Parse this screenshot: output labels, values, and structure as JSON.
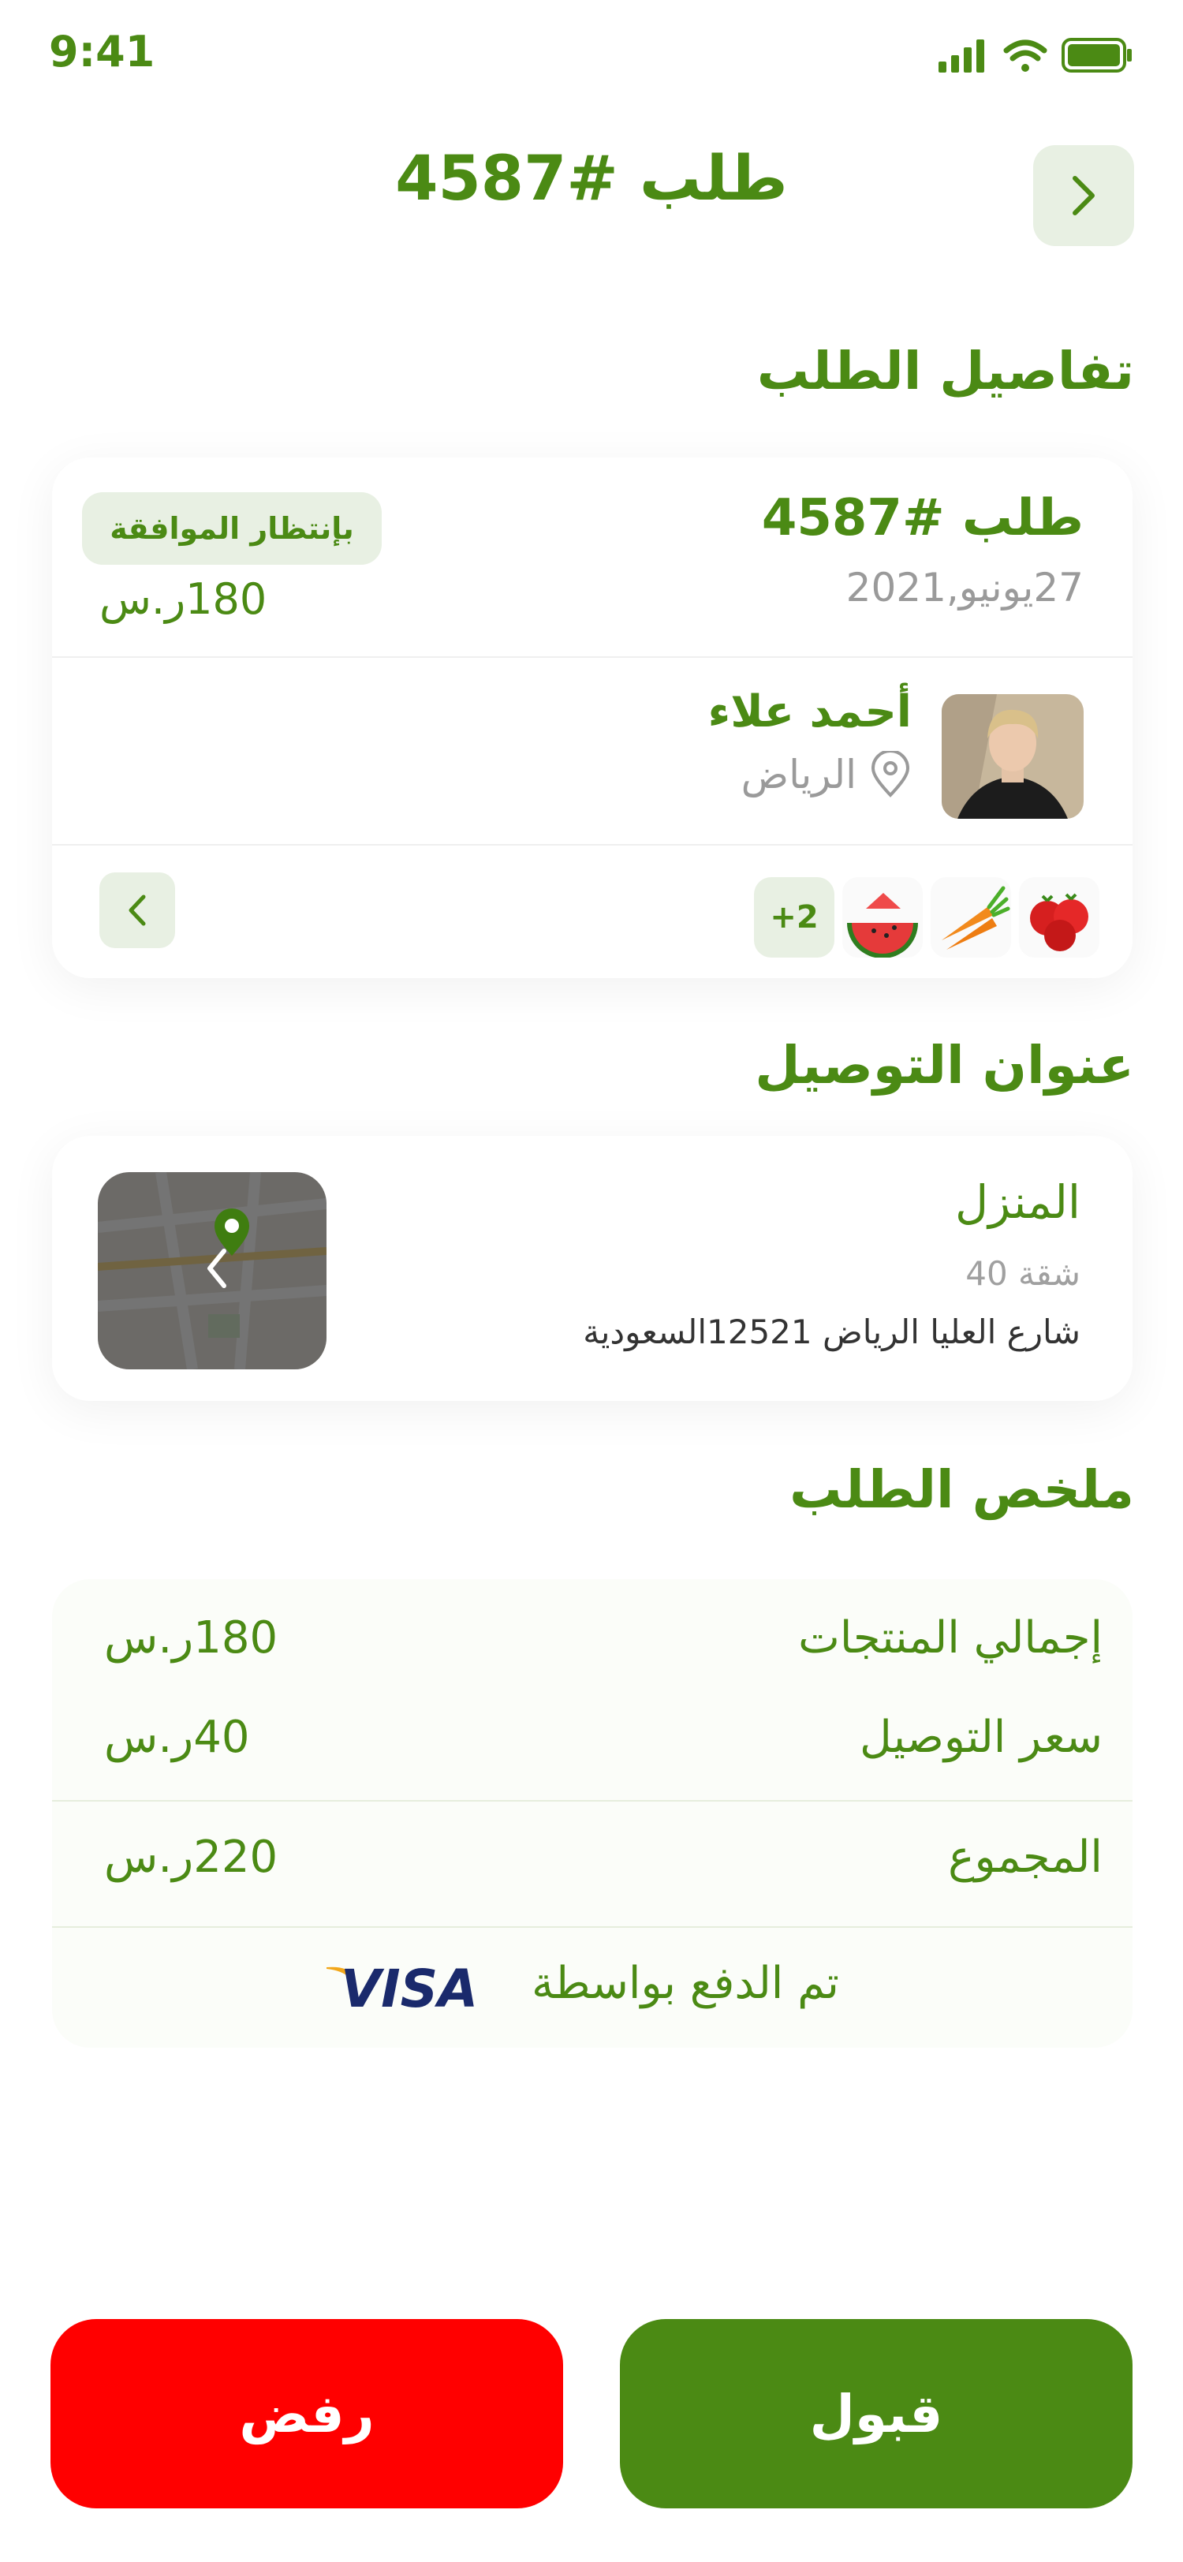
{
  "status_bar": {
    "time": "9:41"
  },
  "header": {
    "title": "طلب #4587",
    "back_icon": "chevron-right-icon"
  },
  "sections": {
    "order_details": "تفاصيل الطلب",
    "delivery_address": "عنوان التوصيل",
    "order_summary": "ملخص الطلب"
  },
  "order": {
    "id": "طلب #4587",
    "date": "27يونيو,2021",
    "status": "بإنتظار الموافقة",
    "price": "180ر.س",
    "customer": {
      "name": "أحمد علاء",
      "city": "الرياض"
    },
    "more_count": "+2",
    "products": [
      "tomatoes",
      "carrots",
      "watermelon"
    ]
  },
  "address": {
    "title": "المنزل",
    "apartment": "شقة 40",
    "line": "شارع العليا الرياض 12521السعودية"
  },
  "summary": {
    "products_total_label": "إجمالي المنتجات",
    "products_total_value": "180ر.س",
    "delivery_label": "سعر التوصيل",
    "delivery_value": "40ر.س",
    "total_label": "المجموع",
    "total_value": "220ر.س",
    "paid_via_label": "تم الدفع بواسطة",
    "payment_brand": "VISA"
  },
  "actions": {
    "accept": "قبول",
    "reject": "رفض"
  },
  "colors": {
    "primary": "#4b8a14",
    "danger": "#ff0000",
    "soft": "#e8f0e3",
    "muted": "#9a9a9a"
  }
}
